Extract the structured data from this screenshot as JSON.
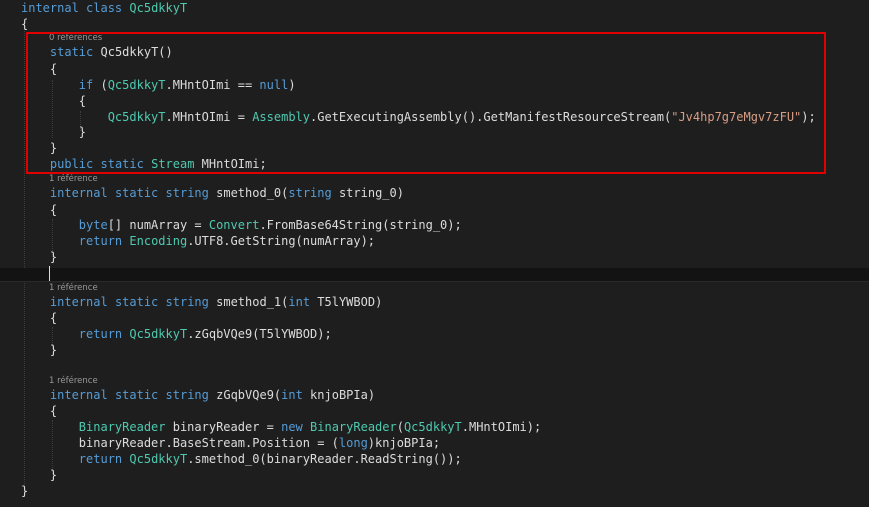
{
  "colors": {
    "background": "#1e1e1e",
    "keyword": "#569cd6",
    "type": "#4ec9b0",
    "string": "#d69d85",
    "plain": "#dcdcdc",
    "codelens": "#999999",
    "highlight_box": "#e00000"
  },
  "code_lines": [
    [
      {
        "t": "internal",
        "c": "kw"
      },
      {
        "t": " "
      },
      {
        "t": "class",
        "c": "kw"
      },
      {
        "t": " "
      },
      {
        "t": "Qc5dkkyT",
        "c": "ty"
      }
    ],
    [
      {
        "t": "{"
      }
    ],
    [
      {
        "t": "    "
      },
      {
        "t": "static",
        "c": "kw"
      },
      {
        "t": " Qc5dkkyT()"
      }
    ],
    [
      {
        "t": "    {"
      }
    ],
    [
      {
        "t": "        "
      },
      {
        "t": "if",
        "c": "kw"
      },
      {
        "t": " ("
      },
      {
        "t": "Qc5dkkyT",
        "c": "ty"
      },
      {
        "t": ".MHntOImi == "
      },
      {
        "t": "null",
        "c": "kw"
      },
      {
        "t": ")"
      }
    ],
    [
      {
        "t": "        {"
      }
    ],
    [
      {
        "t": "            "
      },
      {
        "t": "Qc5dkkyT",
        "c": "ty"
      },
      {
        "t": ".MHntOImi = "
      },
      {
        "t": "Assembly",
        "c": "ty"
      },
      {
        "t": ".GetExecutingAssembly().GetManifestResourceStream("
      },
      {
        "t": "\"Jv4hp7g7eMgv7zFU\"",
        "c": "st"
      },
      {
        "t": ");"
      }
    ],
    [
      {
        "t": "        }"
      }
    ],
    [
      {
        "t": "    }"
      }
    ],
    [
      {
        "t": "    "
      },
      {
        "t": "public",
        "c": "kw"
      },
      {
        "t": " "
      },
      {
        "t": "static",
        "c": "kw"
      },
      {
        "t": " "
      },
      {
        "t": "Stream",
        "c": "ty"
      },
      {
        "t": " MHntOImi;"
      }
    ],
    [
      {
        "t": "    "
      },
      {
        "t": "internal",
        "c": "kw"
      },
      {
        "t": " "
      },
      {
        "t": "static",
        "c": "kw"
      },
      {
        "t": " "
      },
      {
        "t": "string",
        "c": "kw"
      },
      {
        "t": " smethod_0("
      },
      {
        "t": "string",
        "c": "kw"
      },
      {
        "t": " string_0)"
      }
    ],
    [
      {
        "t": "    {"
      }
    ],
    [
      {
        "t": "        "
      },
      {
        "t": "byte",
        "c": "kw"
      },
      {
        "t": "[] numArray = "
      },
      {
        "t": "Convert",
        "c": "ty"
      },
      {
        "t": ".FromBase64String(string_0);"
      }
    ],
    [
      {
        "t": "        "
      },
      {
        "t": "return",
        "c": "kw"
      },
      {
        "t": " "
      },
      {
        "t": "Encoding",
        "c": "ty"
      },
      {
        "t": ".UTF8.GetString(numArray);"
      }
    ],
    [
      {
        "t": "    }"
      }
    ],
    [
      {
        "t": "    "
      },
      {
        "t": "internal",
        "c": "kw"
      },
      {
        "t": " "
      },
      {
        "t": "static",
        "c": "kw"
      },
      {
        "t": " "
      },
      {
        "t": "string",
        "c": "kw"
      },
      {
        "t": " smethod_1("
      },
      {
        "t": "int",
        "c": "kw"
      },
      {
        "t": " T5lYWBOD)"
      }
    ],
    [
      {
        "t": "    {"
      }
    ],
    [
      {
        "t": "        "
      },
      {
        "t": "return",
        "c": "kw"
      },
      {
        "t": " "
      },
      {
        "t": "Qc5dkkyT",
        "c": "ty"
      },
      {
        "t": ".zGqbVQe9(T5lYWBOD);"
      }
    ],
    [
      {
        "t": "    }"
      }
    ],
    [
      {
        "t": "    "
      },
      {
        "t": "internal",
        "c": "kw"
      },
      {
        "t": " "
      },
      {
        "t": "static",
        "c": "kw"
      },
      {
        "t": " "
      },
      {
        "t": "string",
        "c": "kw"
      },
      {
        "t": " zGqbVQe9("
      },
      {
        "t": "int",
        "c": "kw"
      },
      {
        "t": " knjoBPIa)"
      }
    ],
    [
      {
        "t": "    {"
      }
    ],
    [
      {
        "t": "        "
      },
      {
        "t": "BinaryReader",
        "c": "ty"
      },
      {
        "t": " binaryReader = "
      },
      {
        "t": "new",
        "c": "kw"
      },
      {
        "t": " "
      },
      {
        "t": "BinaryReader",
        "c": "ty"
      },
      {
        "t": "("
      },
      {
        "t": "Qc5dkkyT",
        "c": "ty"
      },
      {
        "t": ".MHntOImi);"
      }
    ],
    [
      {
        "t": "        binaryReader.BaseStream.Position = ("
      },
      {
        "t": "long",
        "c": "kw"
      },
      {
        "t": ")knjoBPIa;"
      }
    ],
    [
      {
        "t": "        "
      },
      {
        "t": "return",
        "c": "kw"
      },
      {
        "t": " "
      },
      {
        "t": "Qc5dkkyT",
        "c": "ty"
      },
      {
        "t": ".smethod_0(binaryReader.ReadString());"
      }
    ],
    [
      {
        "t": "    }"
      }
    ],
    [
      {
        "t": "}"
      }
    ]
  ],
  "codelens": [
    "0 références",
    "1 référence",
    "1 référence",
    "1 référence"
  ]
}
